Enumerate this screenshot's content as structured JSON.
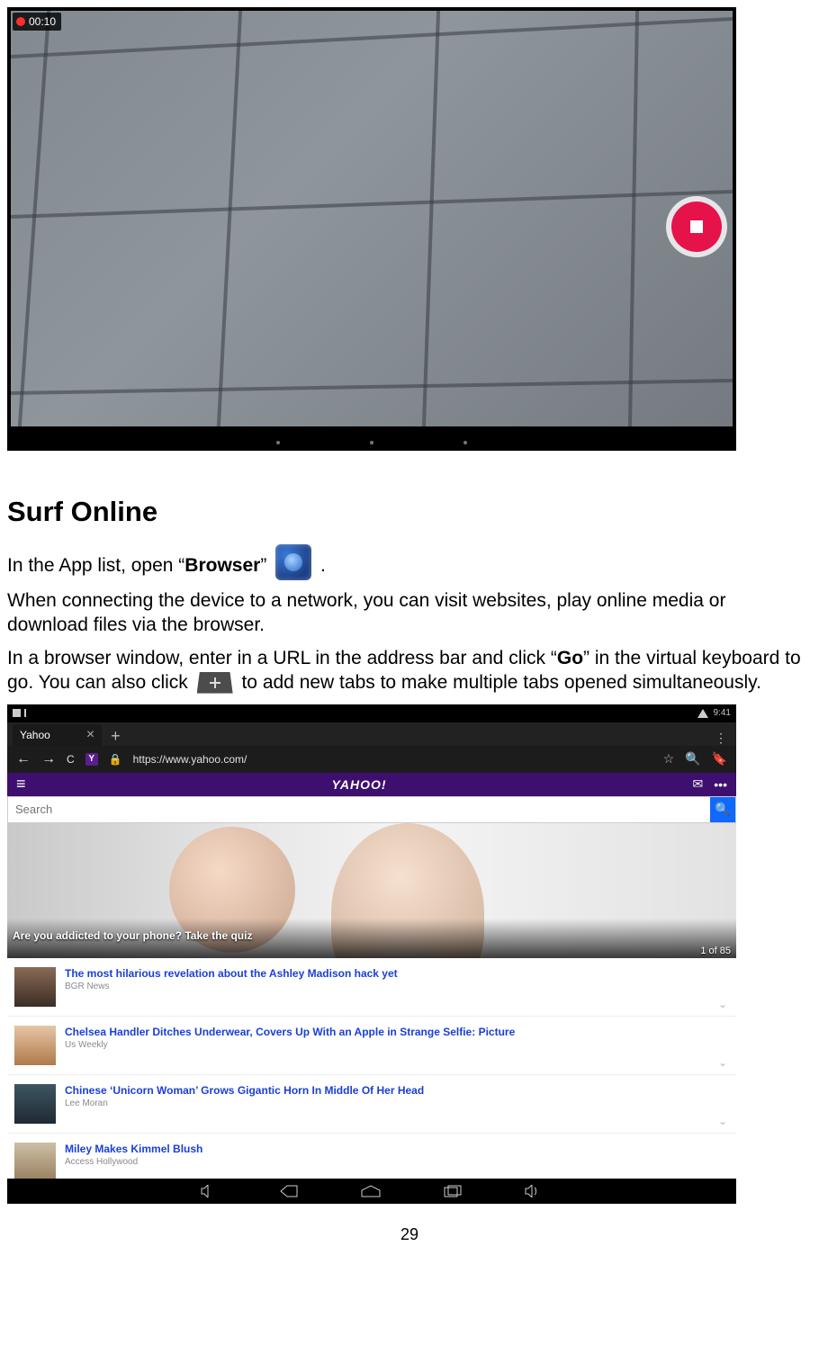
{
  "screenshot1": {
    "timer": "00:10"
  },
  "section_title": "Surf Online",
  "para1_a": "In the App list, open “",
  "para1_b": "Browser",
  "para1_c": "” ",
  "para1_d": " .",
  "para2": "When connecting the device to a network, you can visit websites, play online media or download files via the browser.",
  "para3_a": "In a browser window, enter in a URL in the address bar and click “",
  "para3_b": "Go",
  "para3_c": "” in the virtual keyboard to go. You can also click ",
  "para3_d": " to add new tabs to make multiple tabs opened simultaneously.",
  "screenshot2": {
    "status_time": "9:41",
    "tab_label": "Yahoo",
    "url": "https://www.yahoo.com/",
    "yahoo_logo": "YAHOO!",
    "search_placeholder": "Search",
    "hero_headline": "Are you addicted to your phone? Take the quiz",
    "hero_counter": "1 of 85",
    "articles": [
      {
        "title": "The most hilarious revelation about the Ashley Madison hack yet",
        "source": "BGR News"
      },
      {
        "title": "Chelsea Handler Ditches Underwear, Covers Up With an Apple in Strange Selfie: Picture",
        "source": "Us Weekly"
      },
      {
        "title": "Chinese ‘Unicorn Woman’ Grows Gigantic Horn In Middle Of Her Head",
        "source": "Lee Moran"
      },
      {
        "title": "Miley Makes Kimmel Blush",
        "source": "Access Hollywood"
      }
    ]
  },
  "page_number": "29"
}
